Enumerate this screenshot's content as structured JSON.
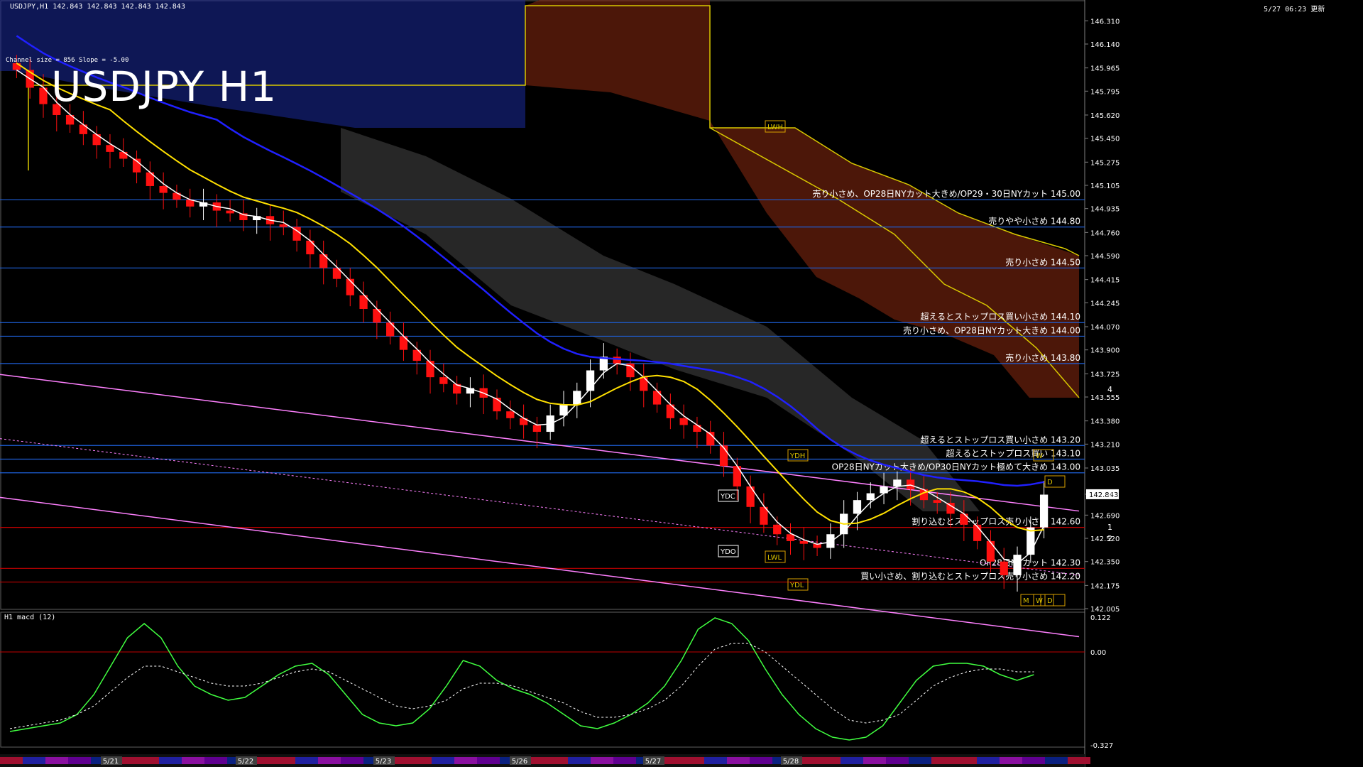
{
  "header": {
    "symbol_info": "USDJPY,H1  142.843 142.843 142.843 142.843",
    "channel_info": "Channel size = 856  Slope = -5.00",
    "timestamp": "5/27 06:23 更新",
    "big_title": "USDJPY H1",
    "indicator_label": "H1  macd (12)"
  },
  "colors": {
    "background": "#000000",
    "grid_blue": "#1e5fd8",
    "grid_red": "#c00000",
    "bull_candle": "#ffffff",
    "bear_candle": "#ff1010",
    "ichimoku_kumo_up": "#8080ff",
    "ichimoku_kumo_down": "#c04020",
    "ma_yellow": "#ffe000",
    "ma_white": "#ffffff",
    "ma_blue": "#2020ff",
    "channel_magenta": "#ff80ff",
    "macd_green": "#40ff40",
    "macd_pink": "#ff90b0"
  },
  "chart_data": [
    {
      "type": "candlestick",
      "title": "USDJPY H1",
      "y_ticks": [
        "146.310",
        "146.140",
        "145.965",
        "145.795",
        "145.620",
        "145.450",
        "145.275",
        "145.105",
        "144.935",
        "144.760",
        "144.590",
        "144.415",
        "144.245",
        "144.070",
        "143.900",
        "143.725",
        "143.555",
        "143.380",
        "143.210",
        "143.035",
        "142.843",
        "142.690",
        "142.520",
        "142.350",
        "142.175",
        "142.005"
      ],
      "ylim": [
        142.0,
        146.4
      ],
      "current_price": "142.843",
      "x_ticks": [
        "5/21",
        "5/22",
        "5/23",
        "5/26",
        "5/27",
        "5/28"
      ],
      "horizontal_levels": [
        {
          "price": 145.0,
          "label": "売り小さめ、OP28日NYカット大きめ/OP29・30日NYカット 145.00",
          "color": "blue"
        },
        {
          "price": 144.8,
          "label": "売りやや小さめ 144.80",
          "color": "blue"
        },
        {
          "price": 144.5,
          "label": "売り小さめ 144.50",
          "color": "blue"
        },
        {
          "price": 144.1,
          "label": "超えるとストップロス買い小さめ 144.10",
          "color": "blue"
        },
        {
          "price": 144.0,
          "label": "売り小さめ、OP28日NYカット大きめ 144.00",
          "color": "blue"
        },
        {
          "price": 143.8,
          "label": "売り小さめ 143.80",
          "color": "blue"
        },
        {
          "price": 143.2,
          "label": "超えるとストップロス買い小さめ 143.20",
          "color": "blue"
        },
        {
          "price": 143.1,
          "label": "超えるとストップロス買い 143.10",
          "color": "blue"
        },
        {
          "price": 143.0,
          "label": "OP28日NYカット大きめ/OP30日NYカット極めて大きめ 143.00",
          "color": "blue"
        },
        {
          "price": 142.6,
          "label": "割り込むとストップロス売り小さめ 142.60",
          "color": "red"
        },
        {
          "price": 142.3,
          "label": "OP28日NYカット 142.30",
          "color": "red"
        },
        {
          "price": 142.2,
          "label": "買い小さめ、割り込むとストップロス売り小さめ 142.20",
          "color": "red"
        }
      ],
      "markers": [
        "LWH",
        "YDH",
        "YDC",
        "YDO",
        "LWL",
        "YDL",
        "W",
        "D",
        "M",
        "W",
        "D"
      ],
      "wave_labels": [
        "4",
        "3",
        "1",
        "2"
      ],
      "closes": [
        145.95,
        145.82,
        145.7,
        145.62,
        145.55,
        145.48,
        145.4,
        145.35,
        145.3,
        145.2,
        145.1,
        145.05,
        145.0,
        144.95,
        144.98,
        144.92,
        144.9,
        144.85,
        144.88,
        144.82,
        144.8,
        144.7,
        144.6,
        144.5,
        144.42,
        144.3,
        144.2,
        144.1,
        144.0,
        143.9,
        143.82,
        143.7,
        143.65,
        143.58,
        143.62,
        143.55,
        143.45,
        143.4,
        143.35,
        143.3,
        143.42,
        143.5,
        143.6,
        143.75,
        143.85,
        143.8,
        143.7,
        143.6,
        143.5,
        143.4,
        143.35,
        143.3,
        143.2,
        143.05,
        142.9,
        142.75,
        142.62,
        142.55,
        142.5,
        142.48,
        142.45,
        142.55,
        142.7,
        142.8,
        142.85,
        142.9,
        142.95,
        142.88,
        142.8,
        142.78,
        142.7,
        142.62,
        142.5,
        142.35,
        142.25,
        142.4,
        142.6,
        142.84
      ]
    },
    {
      "type": "line",
      "title": "H1  macd (12)",
      "y_ticks": [
        "0.122",
        "0.00",
        "-0.327"
      ],
      "ylim": [
        -0.33,
        0.13
      ],
      "macd": [
        -0.28,
        -0.27,
        -0.26,
        -0.25,
        -0.22,
        -0.15,
        -0.05,
        0.05,
        0.1,
        0.05,
        -0.05,
        -0.12,
        -0.15,
        -0.17,
        -0.16,
        -0.12,
        -0.08,
        -0.05,
        -0.04,
        -0.08,
        -0.15,
        -0.22,
        -0.25,
        -0.26,
        -0.25,
        -0.2,
        -0.12,
        -0.03,
        -0.05,
        -0.1,
        -0.13,
        -0.15,
        -0.18,
        -0.22,
        -0.26,
        -0.27,
        -0.25,
        -0.22,
        -0.18,
        -0.12,
        -0.03,
        0.08,
        0.12,
        0.1,
        0.04,
        -0.06,
        -0.15,
        -0.22,
        -0.27,
        -0.3,
        -0.31,
        -0.3,
        -0.26,
        -0.18,
        -0.1,
        -0.05,
        -0.04,
        -0.04,
        -0.05,
        -0.08,
        -0.1,
        -0.08
      ],
      "signal": [
        -0.27,
        -0.26,
        -0.25,
        -0.24,
        -0.22,
        -0.19,
        -0.14,
        -0.09,
        -0.05,
        -0.05,
        -0.07,
        -0.09,
        -0.11,
        -0.12,
        -0.12,
        -0.11,
        -0.09,
        -0.07,
        -0.06,
        -0.07,
        -0.1,
        -0.13,
        -0.16,
        -0.19,
        -0.2,
        -0.19,
        -0.17,
        -0.13,
        -0.11,
        -0.11,
        -0.12,
        -0.14,
        -0.16,
        -0.18,
        -0.21,
        -0.23,
        -0.23,
        -0.22,
        -0.2,
        -0.17,
        -0.12,
        -0.05,
        0.01,
        0.03,
        0.03,
        0.0,
        -0.05,
        -0.1,
        -0.15,
        -0.2,
        -0.24,
        -0.25,
        -0.24,
        -0.22,
        -0.17,
        -0.12,
        -0.09,
        -0.07,
        -0.06,
        -0.06,
        -0.07,
        -0.07
      ]
    }
  ]
}
